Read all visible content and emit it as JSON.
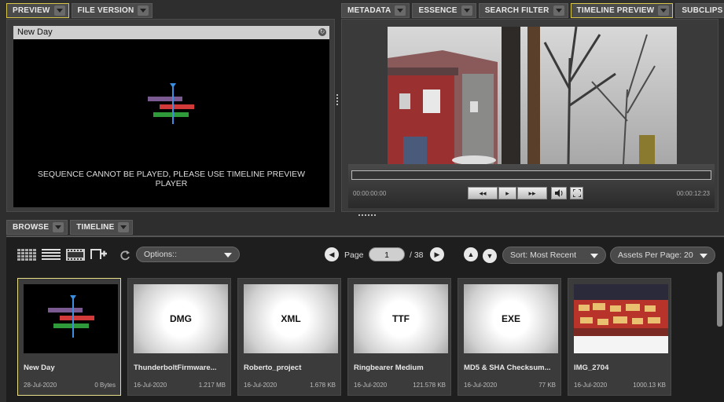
{
  "top_left_tabs": [
    {
      "label": "PREVIEW",
      "highlighted": true
    },
    {
      "label": "FILE VERSION",
      "highlighted": false
    }
  ],
  "top_right_tabs": [
    {
      "label": "METADATA",
      "highlighted": false
    },
    {
      "label": "ESSENCE",
      "highlighted": false
    },
    {
      "label": "SEARCH FILTER",
      "highlighted": false
    },
    {
      "label": "TIMELINE PREVIEW",
      "highlighted": true
    },
    {
      "label": "SUBCLIPS",
      "highlighted": false
    }
  ],
  "preview": {
    "title": "New Day",
    "message": "SEQUENCE CANNOT BE PLAYED, PLEASE USE TIMELINE PREVIEW PLAYER"
  },
  "player": {
    "current_time": "00:00:00:00",
    "duration": "00:00:12:23",
    "rewind_label": "◂◂",
    "play_label": "▸",
    "forward_label": "▸▸"
  },
  "browse_tabs": [
    {
      "label": "BROWSE"
    },
    {
      "label": "TIMELINE"
    }
  ],
  "toolbar": {
    "options_label": "Options::",
    "page_label": "Page",
    "page_value": "1",
    "page_total": "/ 38",
    "sort_label": "Sort: Most Recent",
    "per_page_label": "Assets Per Page: 20"
  },
  "assets": [
    {
      "title": "New Day",
      "date": "28-Jul-2020",
      "size": "0 Bytes",
      "thumb": "sequence",
      "label": "",
      "selected": true
    },
    {
      "title": "ThunderboltFirmware...",
      "date": "16-Jul-2020",
      "size": "1.217 MB",
      "thumb": "generic",
      "label": "DMG",
      "selected": false
    },
    {
      "title": "Roberto_project",
      "date": "16-Jul-2020",
      "size": "1.678 KB",
      "thumb": "generic",
      "label": "XML",
      "selected": false
    },
    {
      "title": "Ringbearer Medium",
      "date": "16-Jul-2020",
      "size": "121.578 KB",
      "thumb": "generic",
      "label": "TTF",
      "selected": false
    },
    {
      "title": "MD5 & SHA Checksum...",
      "date": "16-Jul-2020",
      "size": "77 KB",
      "thumb": "generic",
      "label": "EXE",
      "selected": false
    },
    {
      "title": "IMG_2704",
      "date": "16-Jul-2020",
      "size": "1000.13 KB",
      "thumb": "photo",
      "label": "",
      "selected": false
    }
  ],
  "colors": {
    "highlight": "#d8c64a",
    "timeline_marker": "#3a8fe0",
    "bar_purple": "#7a5a90",
    "bar_red": "#d23a3a",
    "bar_green": "#2e9a3a"
  }
}
